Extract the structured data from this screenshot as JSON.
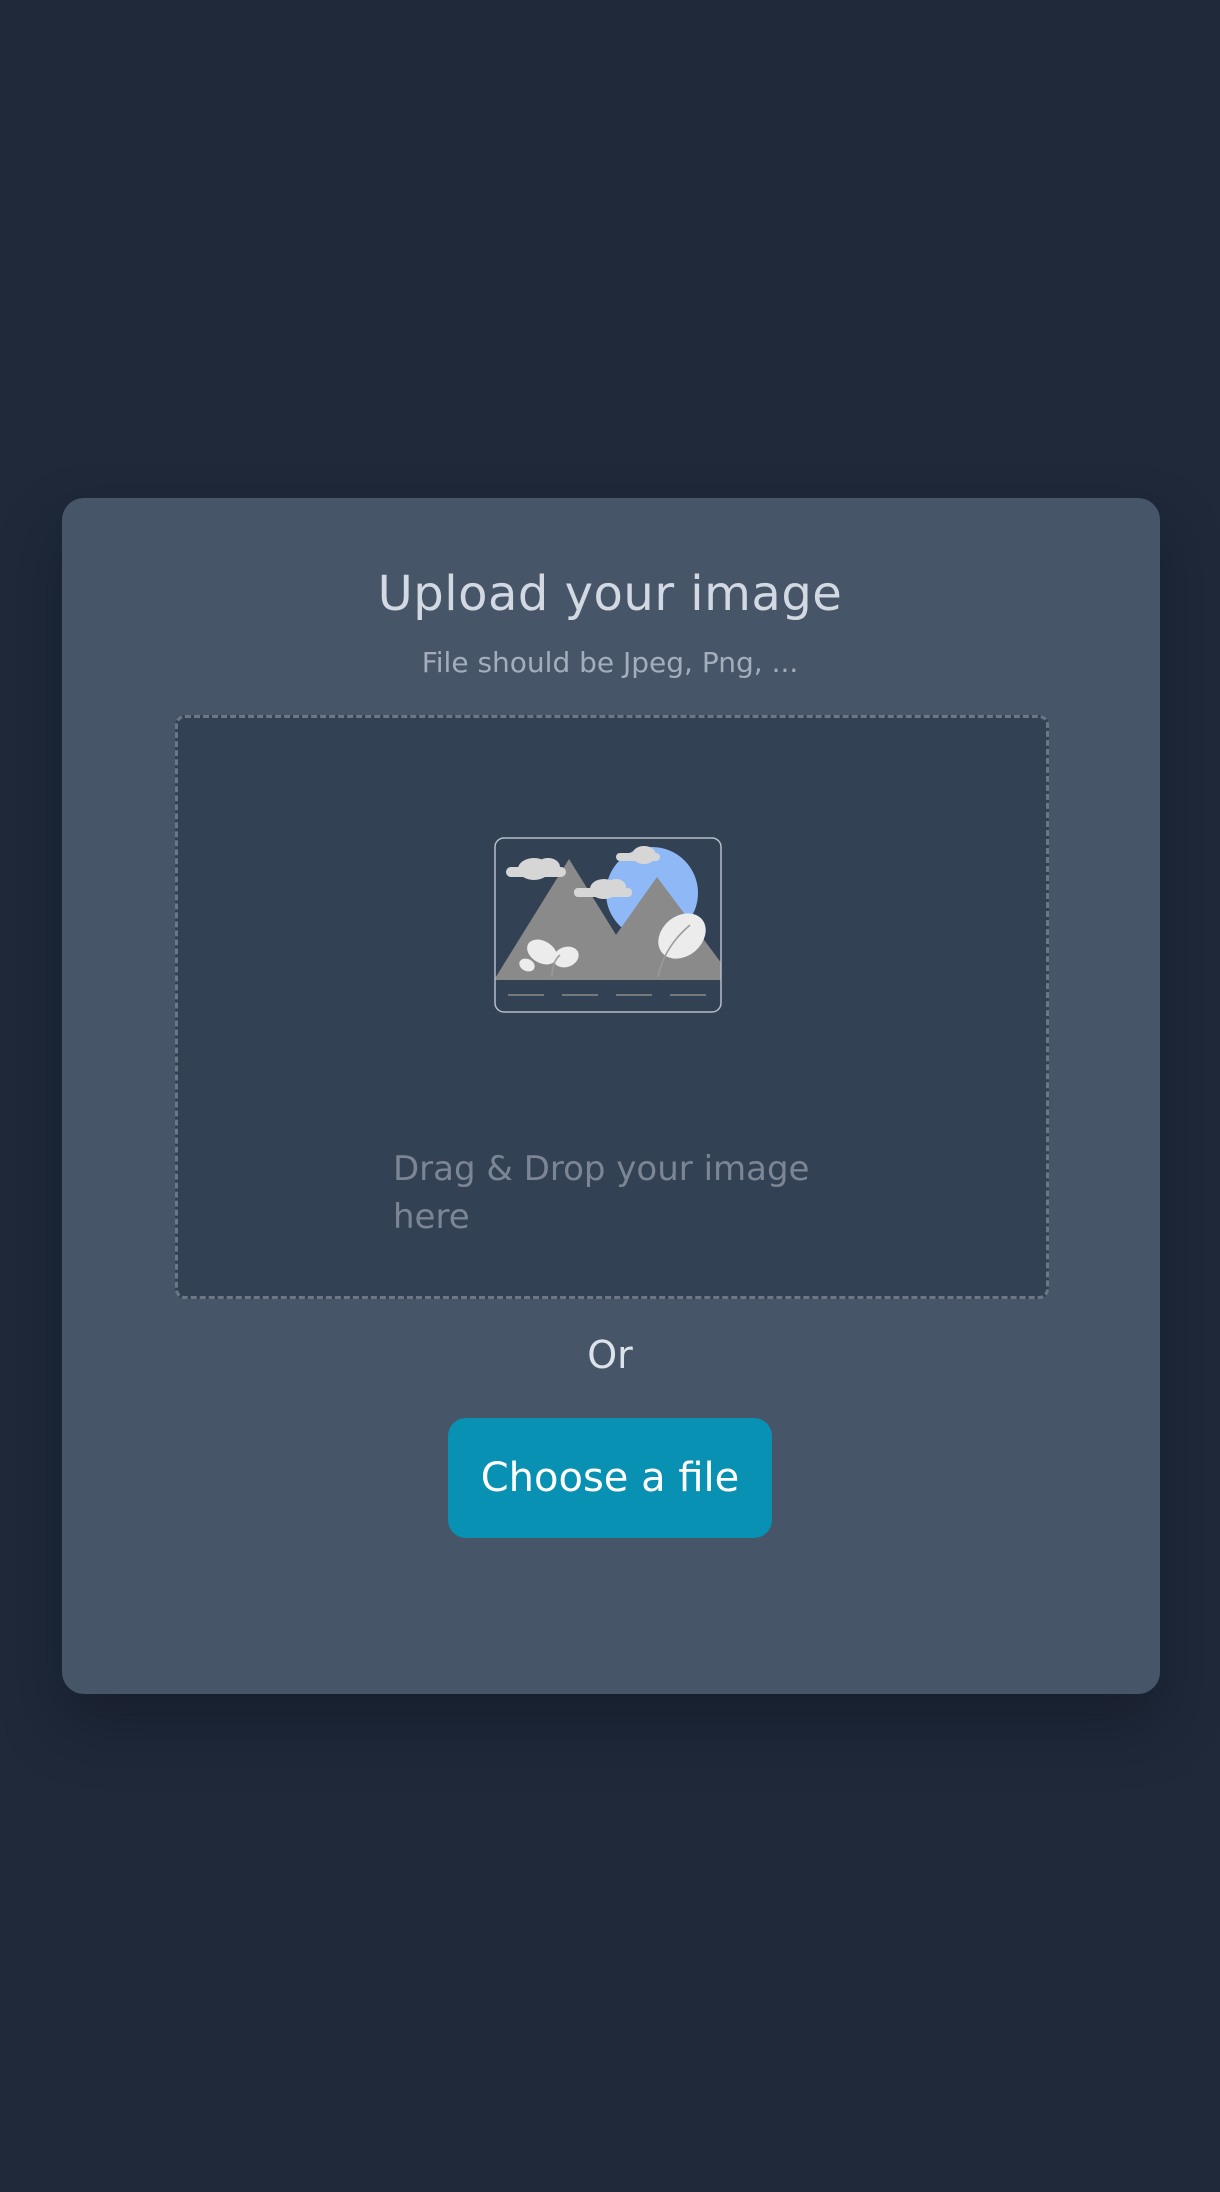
{
  "upload": {
    "title": "Upload your image",
    "subtitle": "File should be Jpeg, Png, ...",
    "drop_text": "Drag & Drop your image here",
    "or_text": "Or",
    "button_label": "Choose a file",
    "illustration_icon": "image-placeholder-icon"
  },
  "colors": {
    "background": "#1f293a",
    "card": "#475569",
    "dropzone": "#334155",
    "button": "#0891b2",
    "sun": "#8fb8f6"
  }
}
